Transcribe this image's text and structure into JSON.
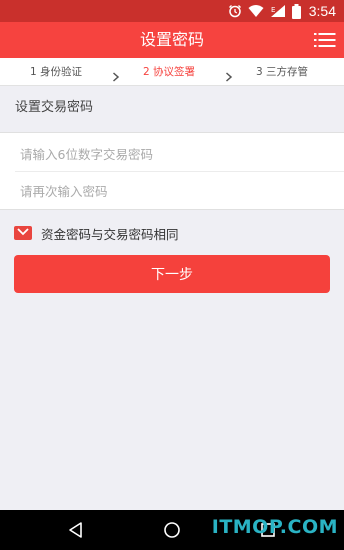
{
  "status_bar": {
    "time": "3:54",
    "icons": [
      "alarm-icon",
      "wifi-icon",
      "signal-e-icon",
      "battery-icon"
    ],
    "background": "#c9302c"
  },
  "header": {
    "title": "设置密码",
    "menu_icon": "list-menu-icon",
    "background": "#f6433f"
  },
  "steps": [
    {
      "label": "1 身份验证",
      "active": false
    },
    {
      "label": "2 协议签署",
      "active": true
    },
    {
      "label": "3 三方存管",
      "active": false
    }
  ],
  "section": {
    "title": "设置交易密码"
  },
  "form": {
    "password_placeholder": "请输入6位数字交易密码",
    "confirm_placeholder": "请再次输入密码",
    "password_value": "",
    "confirm_value": ""
  },
  "checkbox": {
    "label": "资金密码与交易密码相同",
    "checked": true
  },
  "next_button": {
    "label": "下一步"
  },
  "nav": {
    "icons": [
      "back-icon",
      "home-icon",
      "recents-icon"
    ]
  },
  "watermark": {
    "text": "ITMOP.COM"
  },
  "colors": {
    "accent": "#f6433f",
    "background": "#efeff4",
    "watermark": "#2ab3c4"
  }
}
